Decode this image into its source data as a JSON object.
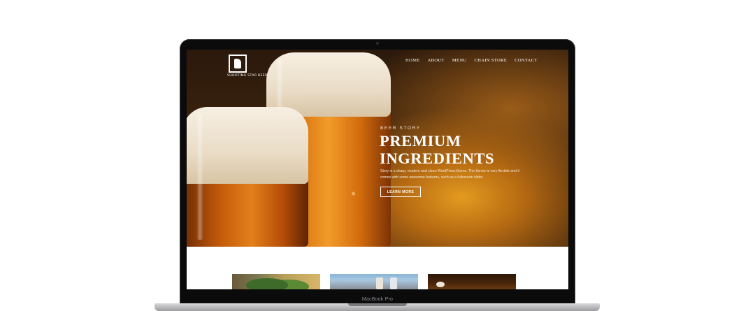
{
  "site": {
    "logo_text": "SHOOTING STAR BEER",
    "nav": [
      {
        "label": "HOME"
      },
      {
        "label": "ABOUT"
      },
      {
        "label": "MENU"
      },
      {
        "label": "CHAIN STORE"
      },
      {
        "label": "CONTACT"
      }
    ],
    "hero": {
      "eyebrow": "BEER STORY",
      "headline_line1": "PREMIUM",
      "headline_line2": "INGREDIENTS",
      "description": "Story is a sharp, modern and clean WordPress theme. The theme is very flexible and it comes with some awesome features, such as a fullscreen slider.",
      "cta_label": "LEARN MORE"
    }
  },
  "device": {
    "label": "MacBook Pro"
  }
}
